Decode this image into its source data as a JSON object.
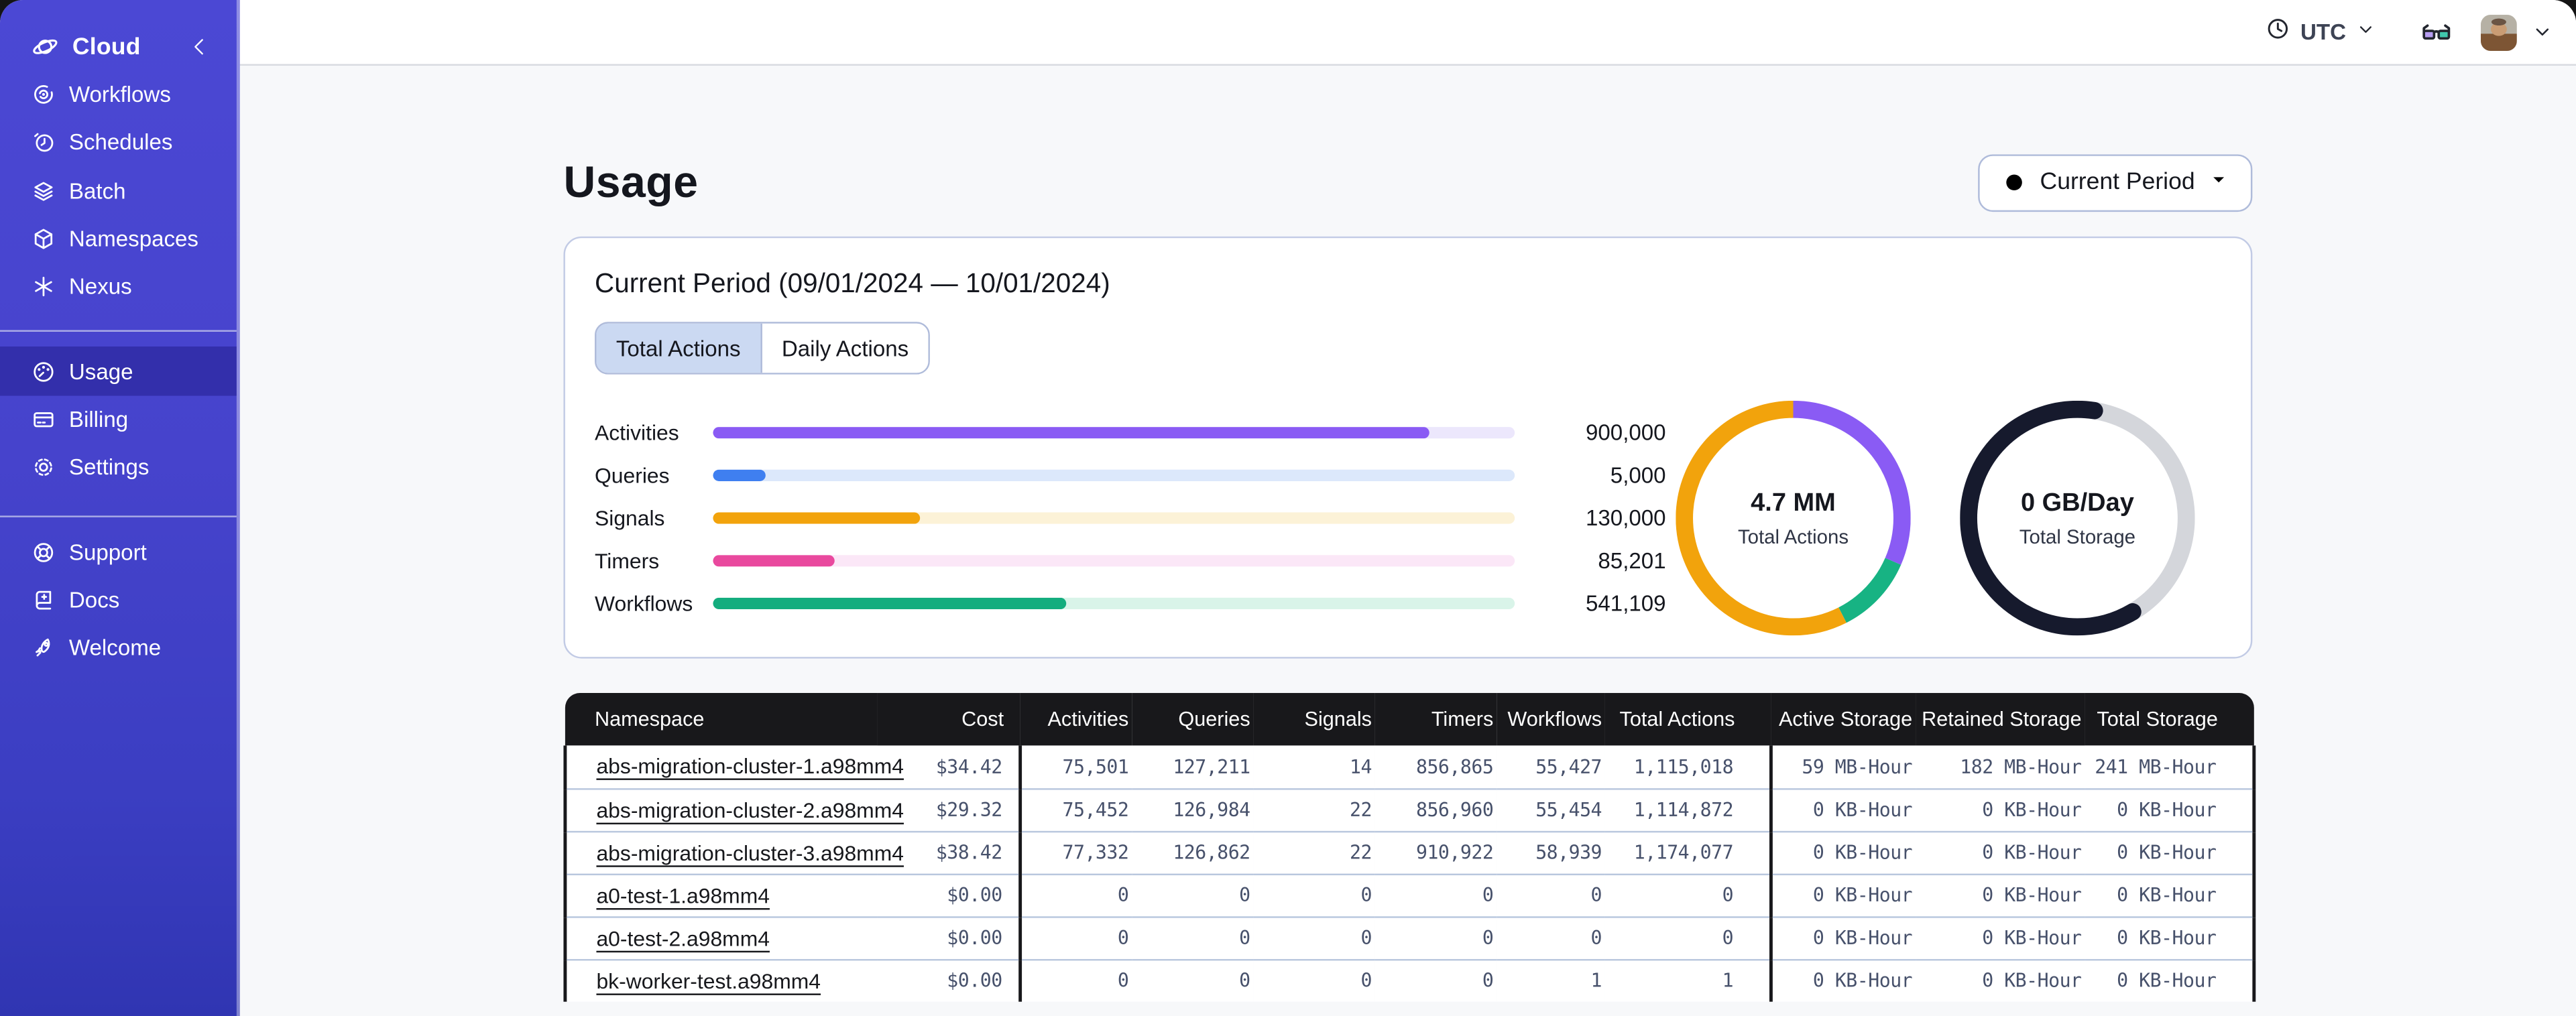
{
  "sidebar": {
    "header": {
      "label": "Cloud",
      "icon": "cloud-orbit-icon"
    },
    "groups": [
      {
        "items": [
          {
            "label": "Workflows",
            "icon": "workflows-icon",
            "selected": false
          },
          {
            "label": "Schedules",
            "icon": "schedules-icon",
            "selected": false
          },
          {
            "label": "Batch",
            "icon": "batch-icon",
            "selected": false
          },
          {
            "label": "Namespaces",
            "icon": "namespaces-icon",
            "selected": false
          },
          {
            "label": "Nexus",
            "icon": "nexus-icon",
            "selected": false
          }
        ]
      },
      {
        "items": [
          {
            "label": "Usage",
            "icon": "usage-gauge-icon",
            "selected": true
          },
          {
            "label": "Billing",
            "icon": "billing-card-icon",
            "selected": false
          },
          {
            "label": "Settings",
            "icon": "settings-gear-icon",
            "selected": false
          }
        ]
      },
      {
        "items": [
          {
            "label": "Support",
            "icon": "support-lifebuoy-icon",
            "selected": false
          },
          {
            "label": "Docs",
            "icon": "docs-book-icon",
            "selected": false
          },
          {
            "label": "Welcome",
            "icon": "welcome-rocket-icon",
            "selected": false
          }
        ]
      }
    ]
  },
  "topbar": {
    "timezone_label": "UTC",
    "icons": [
      "clock-icon",
      "chevron-down-icon",
      "glasses-icon",
      "avatar",
      "chevron-down-icon"
    ]
  },
  "page": {
    "title": "Usage",
    "period_button_label": "Current Period"
  },
  "usage_card": {
    "title": "Current Period (09/01/2024 — 10/01/2024)",
    "tabs": [
      {
        "label": "Total Actions",
        "active": true
      },
      {
        "label": "Daily Actions",
        "active": false
      }
    ]
  },
  "chart_data": [
    {
      "type": "bar",
      "orientation": "horizontal",
      "categories": [
        "Activities",
        "Queries",
        "Signals",
        "Timers",
        "Workflows"
      ],
      "values": [
        900000,
        5000,
        130000,
        85201,
        541109
      ],
      "value_labels": [
        "900,000",
        "5,000",
        "130,000",
        "85,201",
        "541,109"
      ],
      "fill_fractions": [
        0.893,
        0.065,
        0.258,
        0.152,
        0.44
      ],
      "colors": [
        "#8A5BF4",
        "#3F7FF0",
        "#F2A30C",
        "#E9499E",
        "#14AD7E"
      ],
      "track_colors": [
        "#ECE7FC",
        "#DCE8FB",
        "#FCF2D7",
        "#FBE7F7",
        "#D9F4E9"
      ]
    },
    {
      "type": "pie",
      "variant": "donut",
      "center_value": "4.7 MM",
      "center_label": "Total Actions",
      "start_fraction": 0,
      "round_caps": false,
      "segments": [
        {
          "name": "Activities",
          "color": "#8A5BF4",
          "pct": 31.5
        },
        {
          "name": "Workflows",
          "color": "#17B383",
          "pct": 11
        },
        {
          "name": "Signals",
          "color": "#F2A30C",
          "pct": 57.5
        }
      ]
    },
    {
      "type": "pie",
      "variant": "donut",
      "center_value": "0 GB/Day",
      "center_label": "Total Storage",
      "start_fraction": 0.415,
      "round_caps": true,
      "base_color": "#D4D6DB",
      "segments": [
        {
          "name": "used",
          "color": "#161A2D",
          "pct": 61
        }
      ]
    }
  ],
  "table": {
    "columns": [
      "Namespace",
      "Cost",
      "Activities",
      "Queries",
      "Signals",
      "Timers",
      "Workflows",
      "Total Actions",
      "Active Storage",
      "Retained Storage",
      "Total Storage"
    ],
    "rows": [
      {
        "namespace": "abs-migration-cluster-1.a98mm4",
        "cost": "$34.42",
        "activities": "75,501",
        "queries": "127,211",
        "signals": "14",
        "timers": "856,865",
        "workflows": "55,427",
        "total_actions": "1,115,018",
        "active_storage": "59 MB-Hour",
        "retained_storage": "182 MB-Hour",
        "total_storage": "241 MB-Hour"
      },
      {
        "namespace": "abs-migration-cluster-2.a98mm4",
        "cost": "$29.32",
        "activities": "75,452",
        "queries": "126,984",
        "signals": "22",
        "timers": "856,960",
        "workflows": "55,454",
        "total_actions": "1,114,872",
        "active_storage": "0 KB-Hour",
        "retained_storage": "0 KB-Hour",
        "total_storage": "0 KB-Hour"
      },
      {
        "namespace": "abs-migration-cluster-3.a98mm4",
        "cost": "$38.42",
        "activities": "77,332",
        "queries": "126,862",
        "signals": "22",
        "timers": "910,922",
        "workflows": "58,939",
        "total_actions": "1,174,077",
        "active_storage": "0 KB-Hour",
        "retained_storage": "0 KB-Hour",
        "total_storage": "0 KB-Hour"
      },
      {
        "namespace": "a0-test-1.a98mm4",
        "cost": "$0.00",
        "activities": "0",
        "queries": "0",
        "signals": "0",
        "timers": "0",
        "workflows": "0",
        "total_actions": "0",
        "active_storage": "0 KB-Hour",
        "retained_storage": "0 KB-Hour",
        "total_storage": "0 KB-Hour"
      },
      {
        "namespace": "a0-test-2.a98mm4",
        "cost": "$0.00",
        "activities": "0",
        "queries": "0",
        "signals": "0",
        "timers": "0",
        "workflows": "0",
        "total_actions": "0",
        "active_storage": "0 KB-Hour",
        "retained_storage": "0 KB-Hour",
        "total_storage": "0 KB-Hour"
      },
      {
        "namespace": "bk-worker-test.a98mm4",
        "cost": "$0.00",
        "activities": "0",
        "queries": "0",
        "signals": "0",
        "timers": "0",
        "workflows": "1",
        "total_actions": "1",
        "active_storage": "0 KB-Hour",
        "retained_storage": "0 KB-Hour",
        "total_storage": "0 KB-Hour"
      }
    ]
  }
}
